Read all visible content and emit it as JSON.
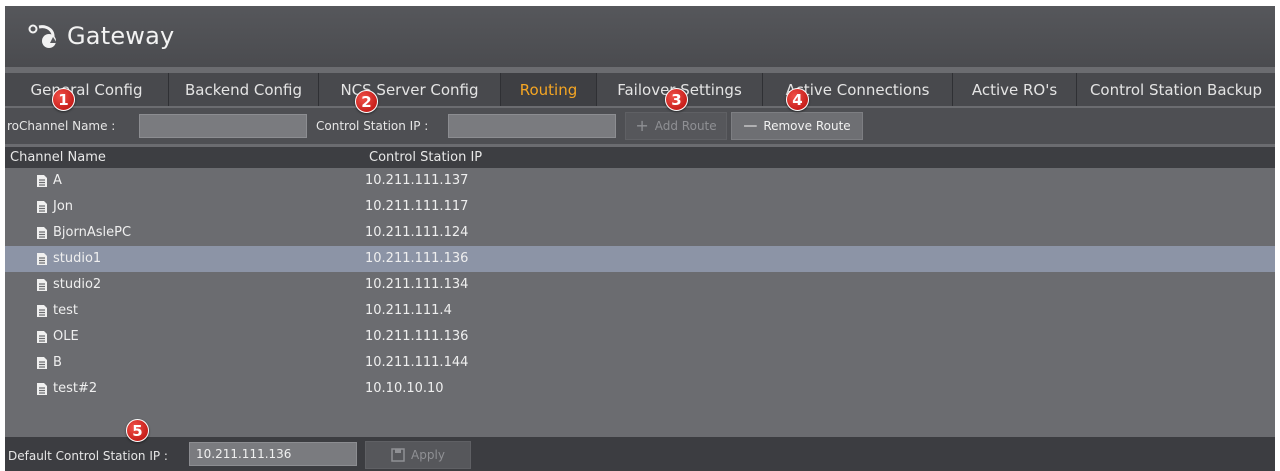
{
  "app": {
    "title": "Gateway",
    "logo_icon": "gateway-logo-icon"
  },
  "tabs": [
    {
      "label": "General Config",
      "active": false
    },
    {
      "label": "Backend Config",
      "active": false
    },
    {
      "label": "NCS Server Config",
      "active": false
    },
    {
      "label": "Routing",
      "active": true
    },
    {
      "label": "Failover Settings",
      "active": false
    },
    {
      "label": "Active Connections",
      "active": false
    },
    {
      "label": "Active RO's",
      "active": false
    },
    {
      "label": "Control Station Backup",
      "active": false
    }
  ],
  "form": {
    "rochannel_label": "roChannel Name :",
    "rochannel_value": "",
    "control_ip_label": "Control Station IP :",
    "control_ip_value": "",
    "add_route_label": "Add Route",
    "remove_route_label": "Remove Route"
  },
  "table": {
    "columns": [
      "Channel Name",
      "Control Station IP"
    ],
    "rows": [
      {
        "name": "A",
        "ip": "10.211.111.137",
        "selected": false
      },
      {
        "name": "Jon",
        "ip": "10.211.111.117",
        "selected": false
      },
      {
        "name": "BjornAslePC",
        "ip": "10.211.111.124",
        "selected": false
      },
      {
        "name": "studio1",
        "ip": "10.211.111.136",
        "selected": true
      },
      {
        "name": "studio2",
        "ip": "10.211.111.134",
        "selected": false
      },
      {
        "name": "test",
        "ip": "10.211.111.4",
        "selected": false
      },
      {
        "name": "OLE",
        "ip": "10.211.111.136",
        "selected": false
      },
      {
        "name": "B",
        "ip": "10.211.111.144",
        "selected": false
      },
      {
        "name": "test#2",
        "ip": "10.10.10.10",
        "selected": false
      }
    ]
  },
  "footer": {
    "default_ip_label": "Default Control Station IP :",
    "default_ip_value": "10.211.111.136",
    "apply_label": "Apply"
  },
  "callouts": [
    "1",
    "2",
    "3",
    "4",
    "5"
  ],
  "colors": {
    "active_tab": "#f5a623",
    "selected_row": "#8c94a6",
    "callout": "#d8302a"
  }
}
